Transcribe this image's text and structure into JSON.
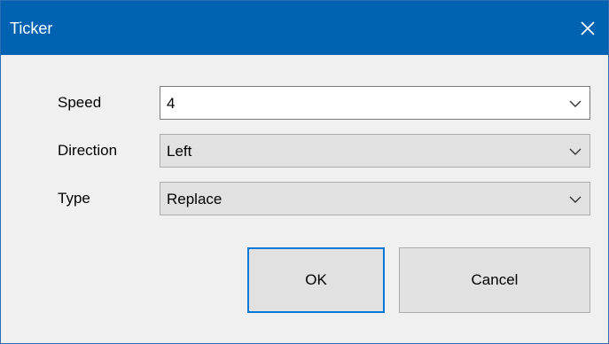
{
  "window": {
    "title": "Ticker"
  },
  "form": {
    "speed": {
      "label": "Speed",
      "value": "4"
    },
    "direction": {
      "label": "Direction",
      "value": "Left"
    },
    "type": {
      "label": "Type",
      "value": "Replace"
    }
  },
  "buttons": {
    "ok_label": "OK",
    "cancel_label": "Cancel"
  },
  "colors": {
    "titlebar": "#0063b1",
    "dialog_background": "#f0f0f0",
    "default_button_border": "#0078d7"
  },
  "icons": {
    "close": "close-icon",
    "dropdown": "chevron-down-icon"
  }
}
